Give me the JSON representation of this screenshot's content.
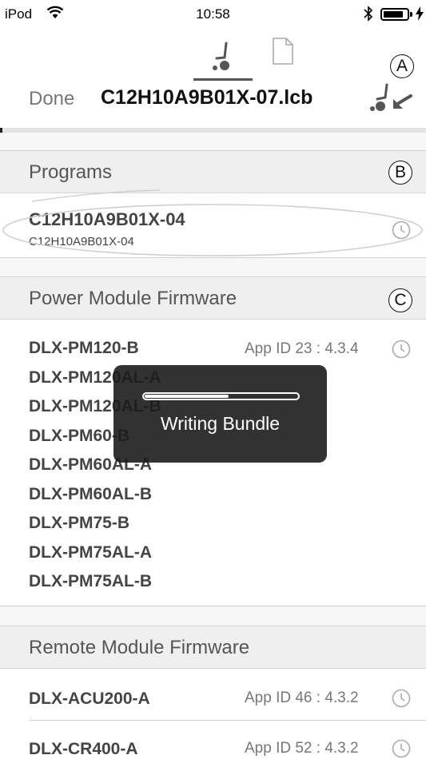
{
  "status_bar": {
    "carrier": "iPod",
    "time": "10:58"
  },
  "nav": {
    "done_label": "Done",
    "filename": "C12H10A9B01X-07.lcb",
    "marker_a": "A"
  },
  "programs": {
    "title": "Programs",
    "marker": "B",
    "items": [
      {
        "name": "C12H10A9B01X-04",
        "subtitle": "C12H10A9B01X-04"
      }
    ]
  },
  "power_module": {
    "title": "Power Module Firmware",
    "marker": "C",
    "app_id": "App ID 23 : 4.3.4",
    "items": [
      "DLX-PM120-B",
      "DLX-PM120AL-A",
      "DLX-PM120AL-B",
      "DLX-PM60-B",
      "DLX-PM60AL-A",
      "DLX-PM60AL-B",
      "DLX-PM75-B",
      "DLX-PM75AL-A",
      "DLX-PM75AL-B"
    ]
  },
  "remote_module": {
    "title": "Remote Module Firmware",
    "items": [
      {
        "name": "DLX-ACU200-A",
        "app_id": "App ID 46 : 4.3.2"
      },
      {
        "name": "DLX-CR400-A",
        "app_id": "App ID 52 : 4.3.2"
      }
    ]
  },
  "hud": {
    "label": "Writing Bundle",
    "progress": 0.55
  },
  "colors": {
    "hud_bg": "#1c1c1c",
    "section_bg": "#efefef",
    "text": "#444444"
  },
  "icons": [
    "wifi-icon",
    "bluetooth-icon",
    "battery-icon",
    "device-tab-icon",
    "document-tab-icon",
    "transfer-icon",
    "clock-icon"
  ]
}
